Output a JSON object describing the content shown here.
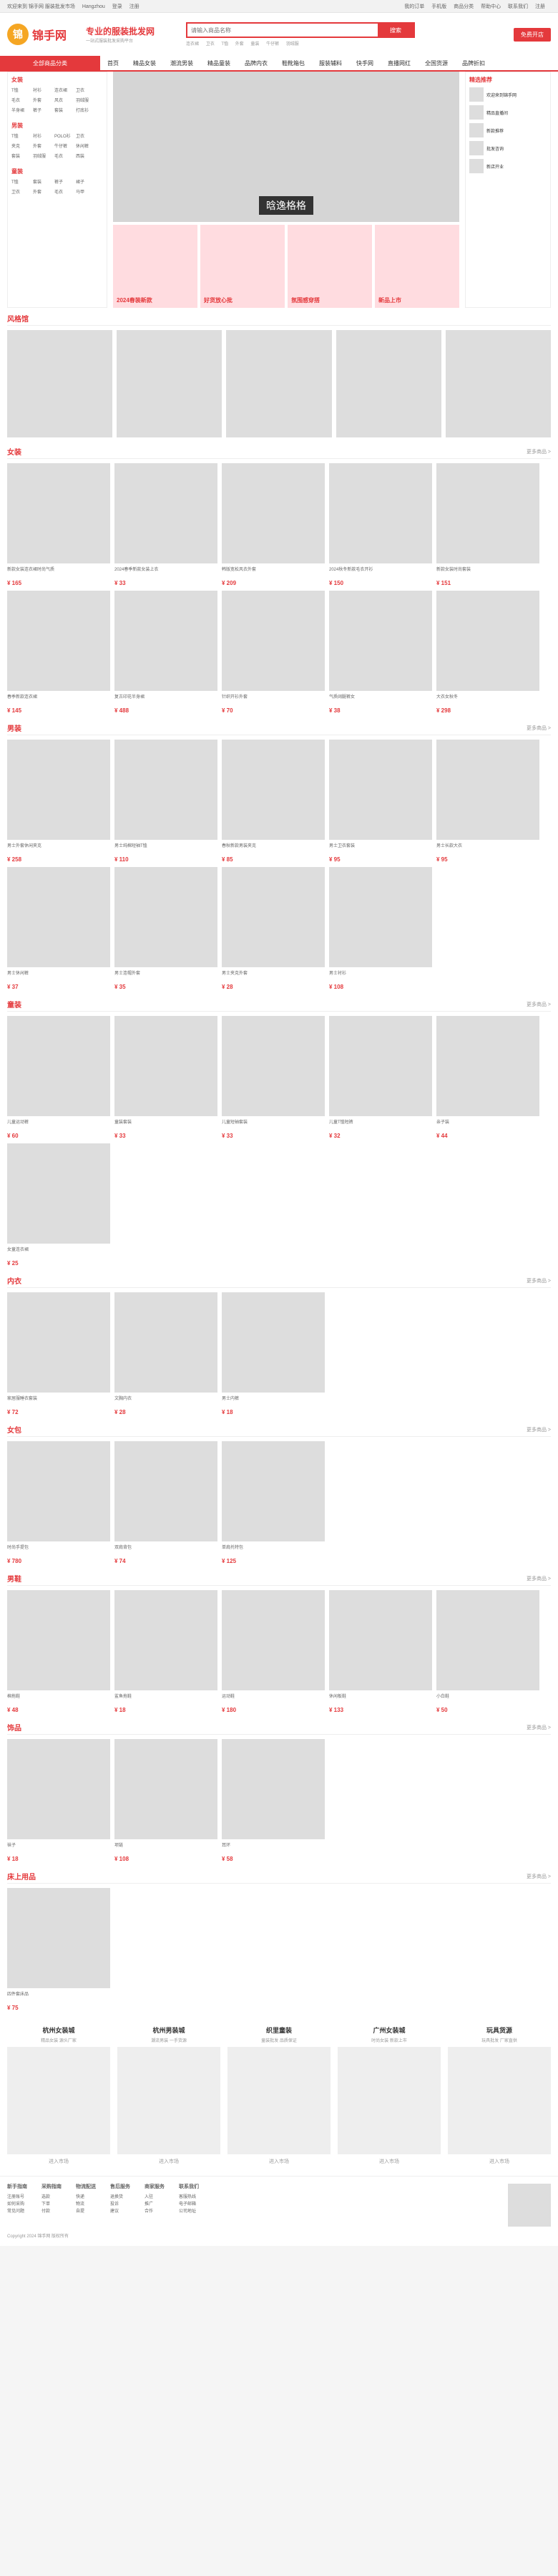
{
  "topbar": {
    "left": [
      "欢迎来到 锦手网 服装批发市场",
      "Hangzhou",
      "登录",
      "注册"
    ],
    "right": [
      "我的订单",
      "手机版",
      "商品分类",
      "帮助中心",
      "联系我们",
      "注册"
    ]
  },
  "logo": {
    "mark": "锦",
    "name": "锦手网"
  },
  "slogan": {
    "line1": "专业的服装批发网",
    "line2": "一站式服装批发采购平台"
  },
  "search": {
    "placeholder": "请输入商品名称",
    "button": "搜索",
    "hot": [
      "连衣裙",
      "卫衣",
      "T恤",
      "外套",
      "童装",
      "牛仔裤",
      "羽绒服"
    ]
  },
  "header_btn": "免费开店",
  "nav": {
    "cat": "全部商品分类",
    "items": [
      "首页",
      "精品女装",
      "潮流男装",
      "精品童装",
      "品牌内衣",
      "鞋靴箱包",
      "服装辅料",
      "快手网",
      "直播网红",
      "全国货源",
      "品牌折扣"
    ]
  },
  "menu": [
    {
      "title": "女装",
      "kids": [
        "T恤",
        "衬衫",
        "连衣裙",
        "卫衣",
        "毛衣",
        "外套",
        "风衣",
        "羽绒服",
        "半身裙",
        "裤子",
        "套装",
        "打底衫"
      ]
    },
    {
      "title": "男装",
      "kids": [
        "T恤",
        "衬衫",
        "POLO衫",
        "卫衣",
        "夹克",
        "外套",
        "牛仔裤",
        "休闲裤",
        "套装",
        "羽绒服",
        "毛衣",
        "西装"
      ]
    },
    {
      "title": "童装",
      "kids": [
        "T恤",
        "套装",
        "裤子",
        "裙子",
        "卫衣",
        "外套",
        "毛衣",
        "马甲"
      ]
    }
  ],
  "banner": {
    "main": "晗逸格格",
    "subs": [
      "2024春装新款",
      "好货放心批",
      "氛围感穿搭",
      "新品上市"
    ]
  },
  "rightbox": {
    "title": "精选推荐",
    "rows": [
      "欢迎来到锦手网",
      "精品直播间",
      "新款推荐",
      "批发咨询",
      "新店开业"
    ]
  },
  "fashion": {
    "title": "风格馆"
  },
  "sections": [
    {
      "title": "女装",
      "more": "更多商品 >",
      "items": [
        {
          "desc": "新款女装连衣裙时尚气质",
          "price": "¥ 165"
        },
        {
          "desc": "2024春季新款女装上衣",
          "price": "¥ 33"
        },
        {
          "desc": "韩版宽松风衣外套",
          "price": "¥ 209"
        },
        {
          "desc": "2024秋冬新款毛衣开衫",
          "price": "¥ 150"
        },
        {
          "desc": "新款女装时尚套装",
          "price": "¥ 151"
        },
        {
          "desc": "春季新款连衣裙",
          "price": "¥ 145"
        },
        {
          "desc": "复古印花半身裙",
          "price": "¥ 488"
        },
        {
          "desc": "针织开衫外套",
          "price": "¥ 70"
        },
        {
          "desc": "气质阔腿裤女",
          "price": "¥ 38"
        },
        {
          "desc": "大衣女秋冬",
          "price": "¥ 298"
        }
      ]
    },
    {
      "title": "男装",
      "more": "更多商品 >",
      "items": [
        {
          "desc": "男士外套休闲夹克",
          "price": "¥ 258"
        },
        {
          "desc": "男士纯棉短袖T恤",
          "price": "¥ 110"
        },
        {
          "desc": "春秋新款男装夹克",
          "price": "¥ 85"
        },
        {
          "desc": "男士卫衣套装",
          "price": "¥ 95"
        },
        {
          "desc": "男士长款大衣",
          "price": "¥ 95"
        },
        {
          "desc": "男士休闲裤",
          "price": "¥ 37"
        },
        {
          "desc": "男士连帽外套",
          "price": "¥ 35"
        },
        {
          "desc": "男士夹克外套",
          "price": "¥ 28"
        },
        {
          "desc": "男士衬衫",
          "price": "¥ 108"
        }
      ]
    },
    {
      "title": "童装",
      "more": "更多商品 >",
      "items": [
        {
          "desc": "儿童运动裤",
          "price": "¥ 60"
        },
        {
          "desc": "童装套装",
          "price": "¥ 33"
        },
        {
          "desc": "儿童短袖套装",
          "price": "¥ 33"
        },
        {
          "desc": "儿童T恤短裤",
          "price": "¥ 32"
        },
        {
          "desc": "亲子装",
          "price": "¥ 44"
        },
        {
          "desc": "女童连衣裙",
          "price": "¥ 25"
        }
      ]
    },
    {
      "title": "内衣",
      "more": "更多商品 >",
      "items": [
        {
          "desc": "家居服睡衣套装",
          "price": "¥ 72"
        },
        {
          "desc": "文胸内衣",
          "price": "¥ 28"
        },
        {
          "desc": "男士内裤",
          "price": "¥ 18"
        }
      ]
    },
    {
      "title": "女包",
      "more": "更多商品 >",
      "items": [
        {
          "desc": "时尚手提包",
          "price": "¥ 780"
        },
        {
          "desc": "双肩背包",
          "price": "¥ 74"
        },
        {
          "desc": "单肩托特包",
          "price": "¥ 125"
        }
      ]
    },
    {
      "title": "男鞋",
      "more": "更多商品 >",
      "items": [
        {
          "desc": "棉拖鞋",
          "price": "¥ 48"
        },
        {
          "desc": "鲨鱼拖鞋",
          "price": "¥ 18"
        },
        {
          "desc": "运动鞋",
          "price": "¥ 180"
        },
        {
          "desc": "休闲板鞋",
          "price": "¥ 133"
        },
        {
          "desc": "小白鞋",
          "price": "¥ 50"
        }
      ]
    },
    {
      "title": "饰品",
      "more": "更多商品 >",
      "items": [
        {
          "desc": "袜子",
          "price": "¥ 18"
        },
        {
          "desc": "项链",
          "price": "¥ 108"
        },
        {
          "desc": "耳环",
          "price": "¥ 58"
        }
      ]
    },
    {
      "title": "床上用品",
      "more": "更多商品 >",
      "items": [
        {
          "desc": "四件套床品",
          "price": "¥ 75"
        }
      ]
    }
  ],
  "markets": [
    {
      "title": "杭州女装城",
      "sub": "精品女装 源头厂家",
      "btn": "进入市场"
    },
    {
      "title": "杭州男装城",
      "sub": "潮流男装 一手货源",
      "btn": "进入市场"
    },
    {
      "title": "织里童装",
      "sub": "童装批发 品质保证",
      "btn": "进入市场"
    },
    {
      "title": "广州女装城",
      "sub": "时尚女装 新款上市",
      "btn": "进入市场"
    },
    {
      "title": "玩具货源",
      "sub": "玩具批发 厂家直供",
      "btn": "进入市场"
    }
  ],
  "footer": {
    "cols": [
      {
        "h": "新手指南",
        "items": [
          "注册账号",
          "如何采购",
          "常见问题"
        ]
      },
      {
        "h": "采购指南",
        "items": [
          "选款",
          "下单",
          "付款"
        ]
      },
      {
        "h": "物流配送",
        "items": [
          "快递",
          "物流",
          "自提"
        ]
      },
      {
        "h": "售后服务",
        "items": [
          "退换货",
          "投诉",
          "建议"
        ]
      },
      {
        "h": "商家服务",
        "items": [
          "入驻",
          "推广",
          "合作"
        ]
      },
      {
        "h": "联系我们",
        "items": [
          "客服热线",
          "电子邮箱",
          "公司地址"
        ]
      }
    ],
    "copy": "Copyright 2024 锦手网 版权所有"
  }
}
